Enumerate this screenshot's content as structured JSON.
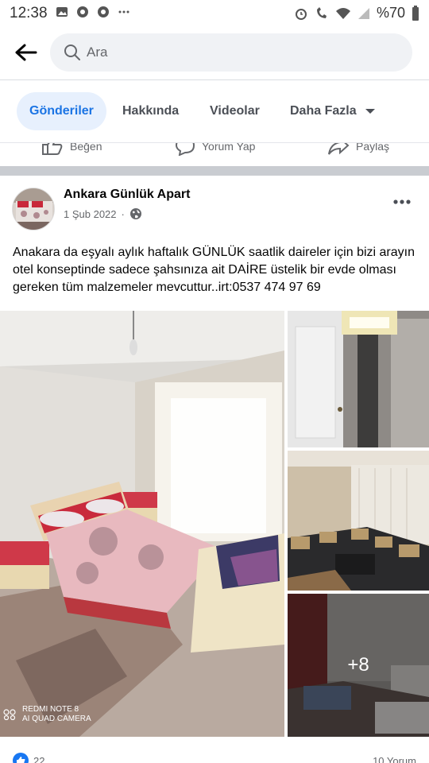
{
  "status_bar": {
    "time": "12:38",
    "battery": "%70",
    "left_icons": [
      "image-icon",
      "chrome-icon",
      "chrome-icon",
      "more-dots"
    ],
    "right_icons": [
      "alarm-icon",
      "wifi-call-icon",
      "wifi-icon",
      "signal-icon"
    ]
  },
  "search": {
    "placeholder": "Ara"
  },
  "tabs": [
    {
      "label": "Gönderiler",
      "active": true
    },
    {
      "label": "Hakkında",
      "active": false
    },
    {
      "label": "Videolar",
      "active": false
    },
    {
      "label": "Daha Fazla",
      "active": false
    }
  ],
  "action_bar": {
    "like": "Beğen",
    "comment": "Yorum Yap",
    "share": "Paylaş"
  },
  "post": {
    "page_name": "Ankara Günlük Apart",
    "date": "1 Şub 2022",
    "privacy_icon": "globe-icon",
    "text": "Anakara da eşyalı aylık haftalık GÜNLÜK saatlik daireler için bizi arayın otel konseptinde sadece şahsınıza ait DAİRE üstelik bir evde olması gereken tüm malzemeler mevcuttur..irt:0537 474 97 69",
    "more_photos": "+8",
    "watermark_line1": "REDMI NOTE 8",
    "watermark_line2": "AI QUAD CAMERA",
    "like_count": "22",
    "comment_count": "10 Yorum"
  },
  "colors": {
    "accent": "#1b74e4",
    "tab_active_bg": "#e7f0fd",
    "search_bg": "#f0f2f5",
    "secondary_text": "#65676b",
    "separator": "#c9ccd1"
  }
}
